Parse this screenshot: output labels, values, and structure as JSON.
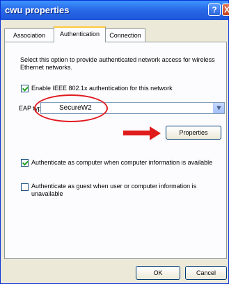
{
  "window": {
    "title": "cwu properties",
    "help_label": "?",
    "close_label": "X"
  },
  "tabs": [
    {
      "label": "Association",
      "active": false
    },
    {
      "label": "Authentication",
      "active": true
    },
    {
      "label": "Connection",
      "active": false
    }
  ],
  "auth": {
    "description": "Select this option to provide authenticated network access for wireless Ethernet networks.",
    "enable_8021x": {
      "label": "Enable IEEE 802.1x authentication for this network",
      "checked": true
    },
    "eap": {
      "label": "EAP type:",
      "value": "SecureW2"
    },
    "properties_label": "Properties",
    "auth_as_computer": {
      "label": "Authenticate as computer when computer information is available",
      "checked": true
    },
    "auth_as_guest": {
      "label": "Authenticate as guest when user or computer information is unavailable",
      "checked": false
    }
  },
  "footer": {
    "ok_label": "OK",
    "cancel_label": "Cancel"
  },
  "colors": {
    "titlebar": "#2a6ae8",
    "annotation": "#e01b1b",
    "tab_highlight": "#ffc83c"
  }
}
